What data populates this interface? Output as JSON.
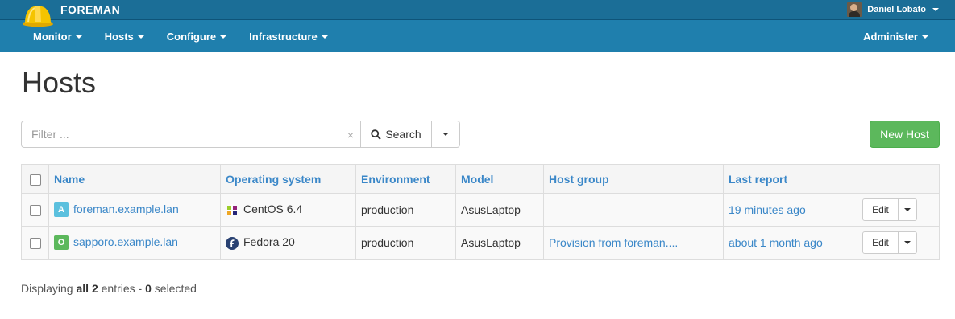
{
  "topbar": {
    "brand": "FOREMAN",
    "user_name": "Daniel Lobato",
    "logo_icon": "hardhat-icon",
    "colors": {
      "topbar": "#1b6e97",
      "navbar": "#1f7fad",
      "helmet": "#f5c400"
    }
  },
  "nav": {
    "items": [
      {
        "label": "Monitor"
      },
      {
        "label": "Hosts"
      },
      {
        "label": "Configure"
      },
      {
        "label": "Infrastructure"
      }
    ],
    "right": "Administer"
  },
  "page": {
    "title": "Hosts"
  },
  "search": {
    "placeholder": "Filter ...",
    "clear": "×",
    "button": "Search",
    "new_host": "New Host"
  },
  "table": {
    "headers": [
      "Name",
      "Operating system",
      "Environment",
      "Model",
      "Host group",
      "Last report"
    ],
    "rows": [
      {
        "badge": "A",
        "badge_color": "#5bc0de",
        "name": "foreman.example.lan",
        "os": "CentOS 6.4",
        "os_icon": "centos-icon",
        "environment": "production",
        "model": "AsusLaptop",
        "host_group": "",
        "last_report": "19 minutes ago",
        "edit": "Edit"
      },
      {
        "badge": "O",
        "badge_color": "#5cb85c",
        "name": "sapporo.example.lan",
        "os": "Fedora 20",
        "os_icon": "fedora-icon",
        "environment": "production",
        "model": "AsusLaptop",
        "host_group": "Provision from foreman....",
        "last_report": "about 1 month ago",
        "edit": "Edit"
      }
    ]
  },
  "footer": {
    "prefix": "Displaying ",
    "all_label": "all 2",
    "middle": " entries - ",
    "selected_count": "0",
    "suffix": " selected"
  }
}
